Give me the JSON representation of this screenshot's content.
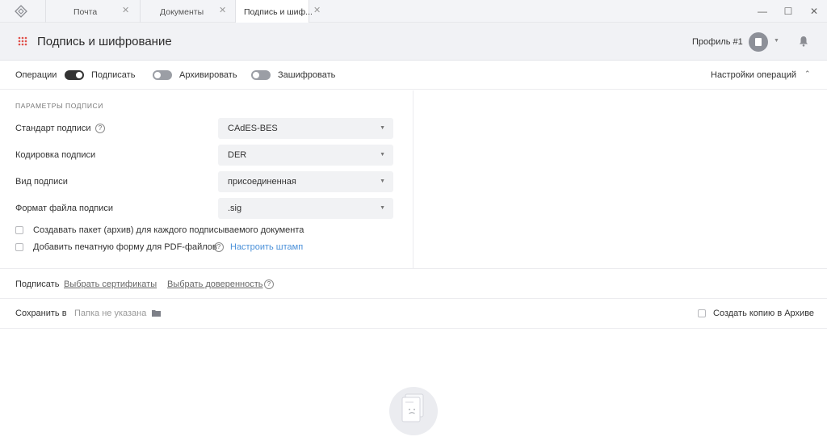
{
  "titlebar": {
    "tabs": [
      {
        "label": "Почта"
      },
      {
        "label": "Документы"
      },
      {
        "label": "Подпись и шиф..."
      }
    ],
    "close_glyph": "✕",
    "minimize_glyph": "—",
    "maximize_glyph": "☐",
    "window_close_glyph": "✕"
  },
  "header": {
    "title": "Подпись и шифрование",
    "profile": "Профиль #1",
    "caret": "▼"
  },
  "operations": {
    "label": "Операции",
    "items": [
      {
        "label": "Подписать",
        "on": true
      },
      {
        "label": "Архивировать",
        "on": false
      },
      {
        "label": "Зашифровать",
        "on": false
      }
    ],
    "settings": "Настройки операций",
    "chevron": "⌃"
  },
  "params": {
    "section_title": "ПАРАМЕТРЫ ПОДПИСИ",
    "help_glyph": "?",
    "fields": [
      {
        "label": "Стандарт подписи",
        "value": "CAdES-BES"
      },
      {
        "label": "Кодировка подписи",
        "value": "DER"
      },
      {
        "label": "Вид подписи",
        "value": "присоединенная"
      },
      {
        "label": "Формат файла подписи",
        "value": ".sig"
      }
    ],
    "select_caret": "▼",
    "checkboxes": [
      {
        "label": "Создавать пакет (архив) для каждого подписываемого документа",
        "checked": false
      },
      {
        "label": "Добавить печатную форму для PDF-файлов",
        "checked": false
      }
    ],
    "stamp_link": "Настроить штамп"
  },
  "sign": {
    "label": "Подписать",
    "choose_cert": "Выбрать сертификаты",
    "choose_proxy": "Выбрать доверенность"
  },
  "save": {
    "label": "Сохранить в",
    "folder_placeholder": "Папка не указана",
    "archive_copy": "Создать копию в Архиве"
  },
  "colors": {
    "accent_link": "#4a90d9",
    "grid_icon": "#e0504a",
    "toggle_on": "#333333",
    "toggle_off": "#9b9ea5"
  },
  "icons": [
    "app-logo-icon",
    "grid-menu-icon",
    "bell-icon",
    "help-icon",
    "folder-icon",
    "empty-document-icon"
  ]
}
